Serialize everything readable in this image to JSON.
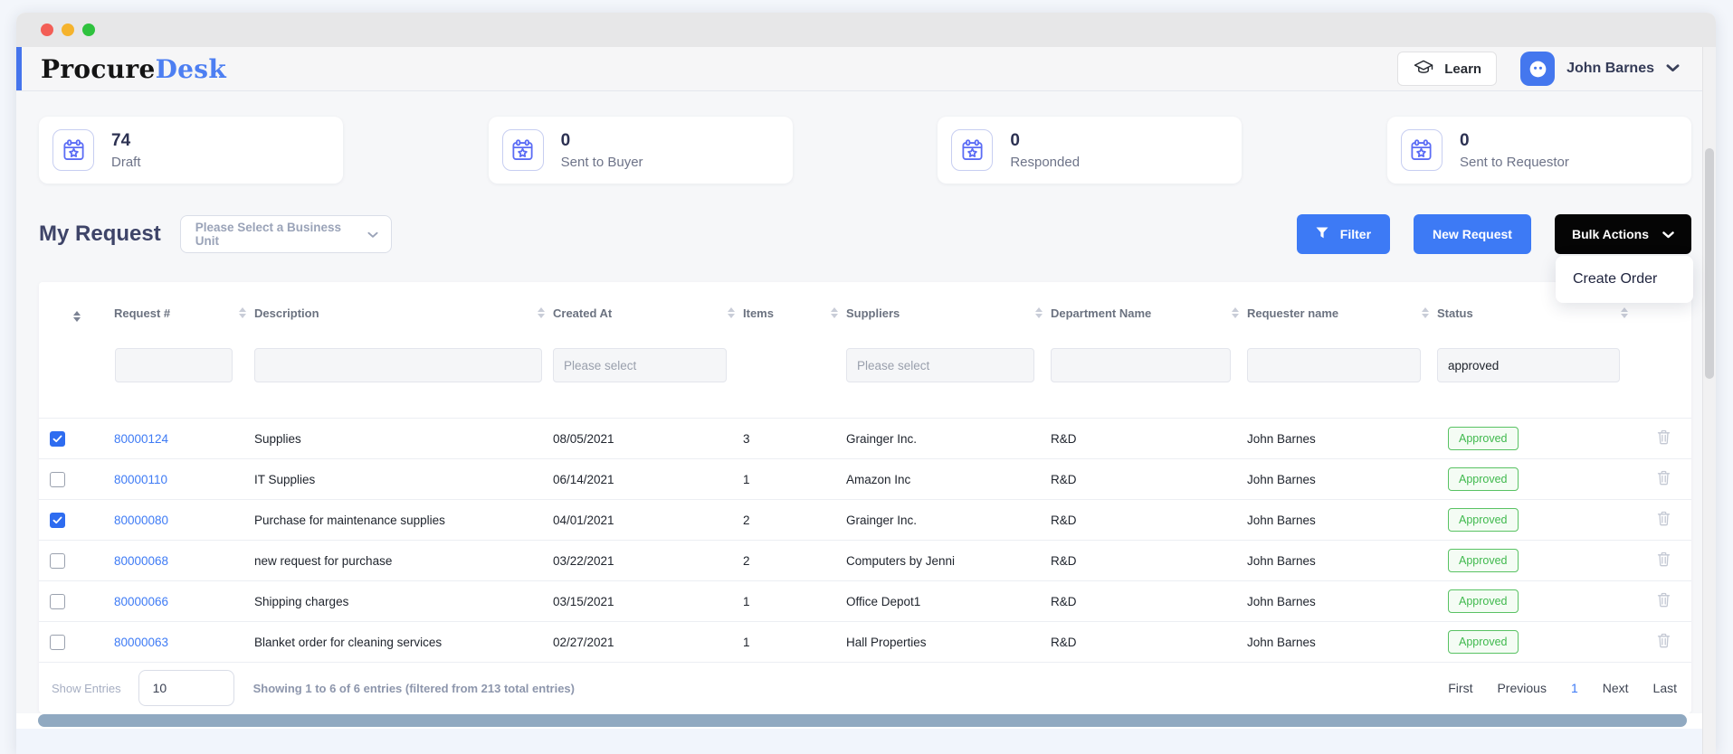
{
  "header": {
    "logo_primary": "Procure",
    "logo_accent": "Desk",
    "learn_label": "Learn",
    "user_name": "John Barnes"
  },
  "stats": [
    {
      "value": "74",
      "label": "Draft"
    },
    {
      "value": "0",
      "label": "Sent to Buyer"
    },
    {
      "value": "0",
      "label": "Responded"
    },
    {
      "value": "0",
      "label": "Sent to Requestor"
    }
  ],
  "toolbar": {
    "title": "My Request",
    "business_unit_placeholder": "Please Select a Business Unit",
    "filter_label": "Filter",
    "new_request_label": "New Request",
    "bulk_actions_label": "Bulk Actions",
    "bulk_menu_items": [
      "Create Order"
    ]
  },
  "table": {
    "columns": [
      "Request #",
      "Description",
      "Created At",
      "Items",
      "Suppliers",
      "Department Name",
      "Requester name",
      "Status"
    ],
    "filters": {
      "created_at_placeholder": "Please select",
      "suppliers_placeholder": "Please select",
      "status_value": "approved"
    },
    "rows": [
      {
        "checked": true,
        "request_no": "80000124",
        "description": "Supplies",
        "created_at": "08/05/2021",
        "items": "3",
        "supplier": "Grainger Inc.",
        "department": "R&D",
        "requester": "John Barnes",
        "status": "Approved"
      },
      {
        "checked": false,
        "request_no": "80000110",
        "description": "IT Supplies",
        "created_at": "06/14/2021",
        "items": "1",
        "supplier": "Amazon Inc",
        "department": "R&D",
        "requester": "John Barnes",
        "status": "Approved"
      },
      {
        "checked": true,
        "request_no": "80000080",
        "description": "Purchase for maintenance supplies",
        "created_at": "04/01/2021",
        "items": "2",
        "supplier": "Grainger Inc.",
        "department": "R&D",
        "requester": "John Barnes",
        "status": "Approved"
      },
      {
        "checked": false,
        "request_no": "80000068",
        "description": "new request for purchase",
        "created_at": "03/22/2021",
        "items": "2",
        "supplier": "Computers by Jenni",
        "department": "R&D",
        "requester": "John Barnes",
        "status": "Approved"
      },
      {
        "checked": false,
        "request_no": "80000066",
        "description": "Shipping charges",
        "created_at": "03/15/2021",
        "items": "1",
        "supplier": "Office Depot1",
        "department": "R&D",
        "requester": "John Barnes",
        "status": "Approved"
      },
      {
        "checked": false,
        "request_no": "80000063",
        "description": "Blanket order for cleaning services",
        "created_at": "02/27/2021",
        "items": "1",
        "supplier": "Hall Properties",
        "department": "R&D",
        "requester": "John Barnes",
        "status": "Approved"
      }
    ]
  },
  "footer": {
    "show_entries_label": "Show Entries",
    "entries_value": "10",
    "summary": "Showing 1 to 6 of 6 entries (filtered from 213 total entries)",
    "pagination": [
      "First",
      "Previous",
      "1",
      "Next",
      "Last"
    ],
    "active_page": "1"
  },
  "colors": {
    "accent_blue": "#3d7af5",
    "link_blue": "#3e7bf5",
    "badge_green": "#3fb94d",
    "bulk_button_black": "#050505",
    "scrollbar_thumb": "#90a9c1",
    "header_accent_bar": "#4574ec"
  }
}
